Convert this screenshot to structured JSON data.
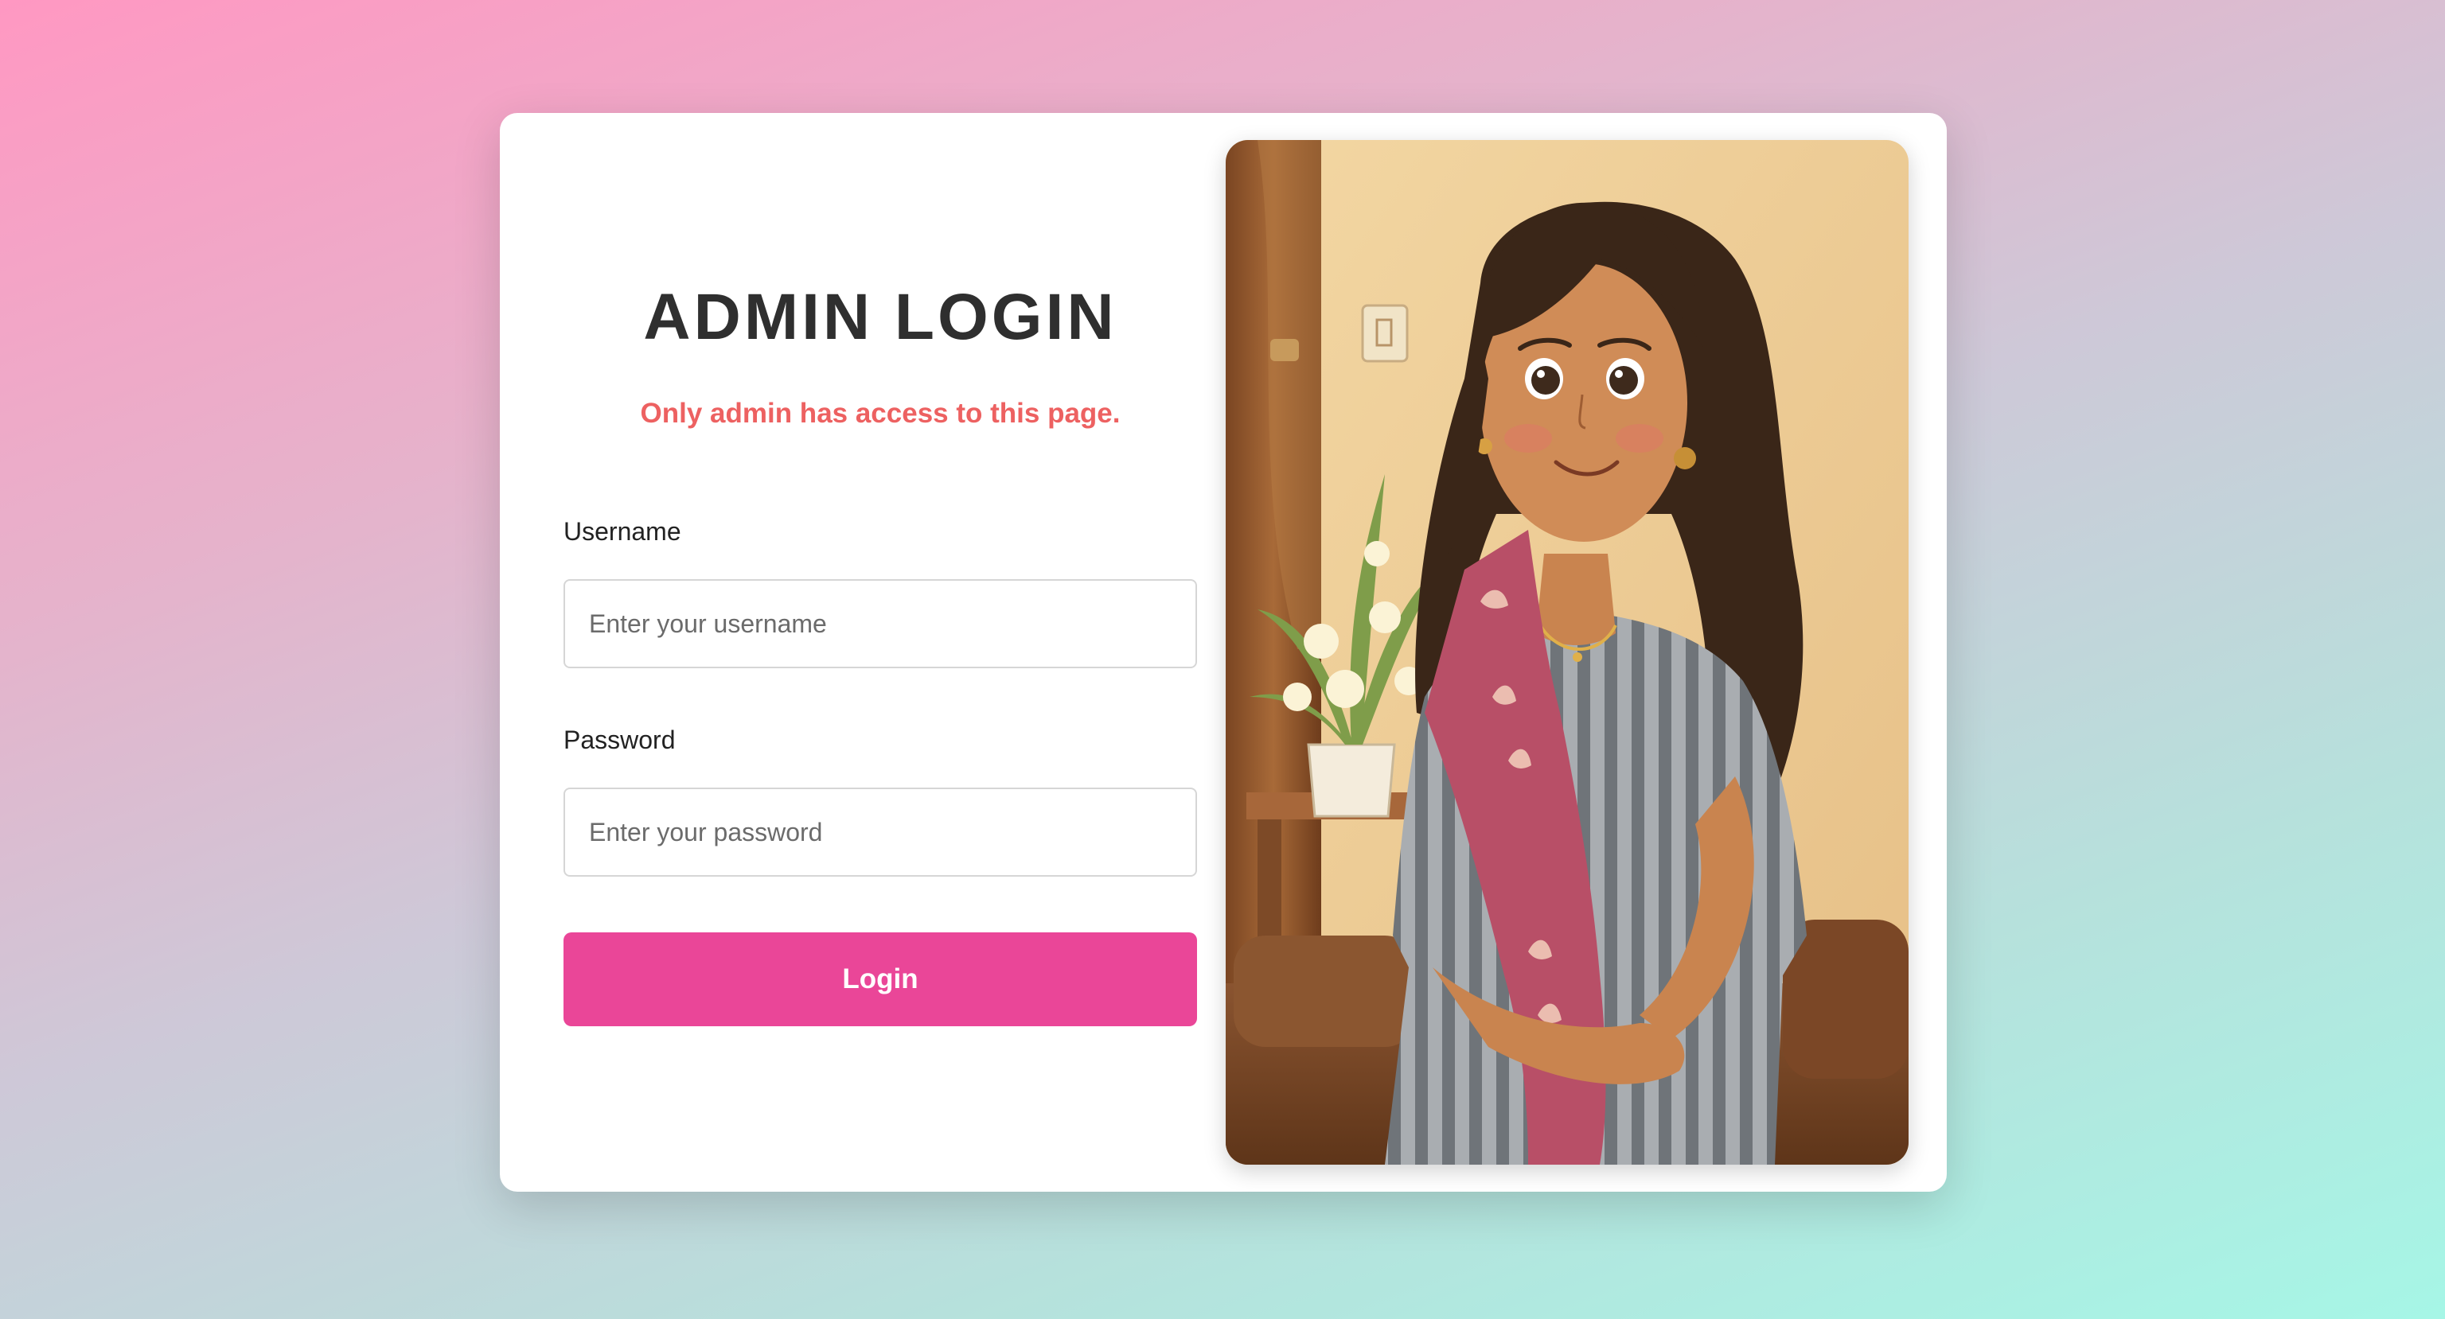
{
  "login": {
    "title": "ADMIN LOGIN",
    "subtitle": "Only admin has access to this page.",
    "username_label": "Username",
    "username_placeholder": "Enter your username",
    "username_value": "",
    "password_label": "Password",
    "password_placeholder": "Enter your password",
    "password_value": "",
    "submit_label": "Login"
  },
  "colors": {
    "background_from": "#ff98c2",
    "background_to": "#a6f6e6",
    "card": "#ffffff",
    "title": "#2f2f2f",
    "subtitle": "#ed6161",
    "button": "#ea4698",
    "button_text": "#ffffff"
  }
}
